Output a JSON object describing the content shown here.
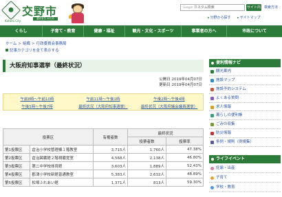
{
  "header": {
    "site_title": "交野市",
    "site_sub": "Katano City",
    "tagline": "星のまち かたの",
    "search_prefix": "Google",
    "search_placeholder": "カスタム検索",
    "search_button": "サイト内検索",
    "search_method": "検索方法",
    "util_links": [
      "分野から探す",
      "サイトマップ"
    ]
  },
  "gnav": {
    "items": [
      "くらし",
      "子育て・教育",
      "健康・福祉",
      "観光・文化・スポーツ",
      "事業者の方へ",
      "市政について"
    ]
  },
  "breadcrumb": [
    "ホーム",
    "組織",
    "行政委員会事務局"
  ],
  "show_all_label": "記事カテゴリを全て表示する",
  "page": {
    "title": "大阪府知事選挙（最終状況）",
    "published": "公開日 2019年04月07日",
    "updated": "更新日 2019年04月07日"
  },
  "jump_links": [
    "午前8時～午前10時",
    "午前11時～午後1時",
    "午後2時～午後4時",
    "午後5時～午後7時",
    "最終状況（大阪府知事選挙）",
    "最終状況（大阪府議会議員選挙）"
  ],
  "table": {
    "header_district": "投票区",
    "header_voters": "有権者数",
    "header_final": "最終状況",
    "header_count": "投票者数",
    "header_rate": "投票率",
    "rows": [
      {
        "district": "第1投票区",
        "place": "倉治小学校管理棟１階教室",
        "voters": "3,715人",
        "count": "1,760人",
        "rate": "47.38%"
      },
      {
        "district": "第2投票区",
        "place": "倉治図書館２階視聴覚室",
        "voters": "4,568人",
        "count": "2,138人",
        "rate": "46.80%"
      },
      {
        "district": "第3投票区",
        "place": "第二中学校体育館",
        "voters": "3,603人",
        "count": "1,889人",
        "rate": "52.43%"
      },
      {
        "district": "第4投票区",
        "place": "郡津小学校新館普通教室",
        "voters": "5,383人",
        "count": "2,632人",
        "rate": "48.89%"
      },
      {
        "district": "第5投票区",
        "place": "松塚ふれあい館",
        "voters": "1,371人",
        "count": "813人",
        "rate": "59.30%"
      }
    ]
  },
  "sidebar": {
    "nav_title": "便利情報ナビ",
    "nav_items": [
      "観光案内",
      "施設マップ",
      "施設予約システム",
      "よくある質問",
      "求人情報",
      "暮らしの便利帳",
      "ごみの収集",
      "防災情報",
      "条例・規則（例規集）"
    ],
    "nav_colors": [
      "#2d7b3a",
      "#3a8ac0",
      "#c05a3a",
      "#8a5ac0",
      "#d2a030",
      "#3aa07a",
      "#7a9a3a",
      "#c03a3a",
      "#5a5a9a"
    ],
    "life_title": "ライフイベント",
    "life_items": [
      "妊娠・出産",
      "子育て",
      "学校・教育"
    ],
    "life_colors": [
      "#e07aa0",
      "#e0a040",
      "#4a9ad0"
    ]
  }
}
